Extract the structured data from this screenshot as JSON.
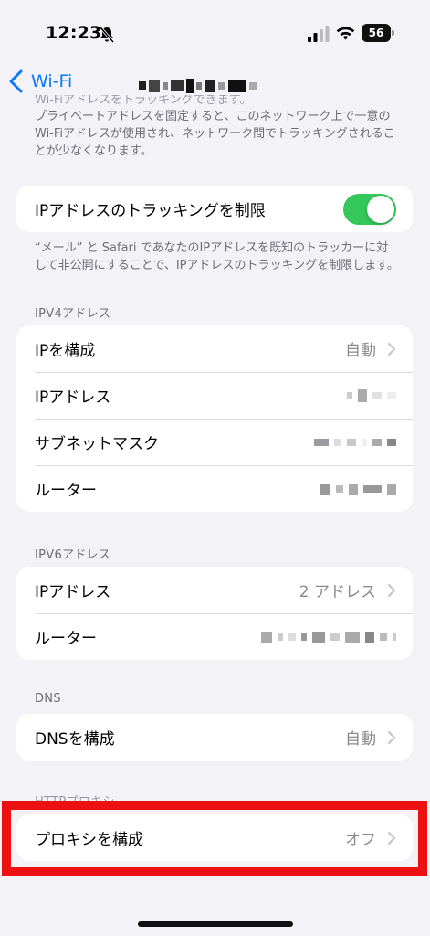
{
  "status": {
    "time": "12:23",
    "battery": "56"
  },
  "nav": {
    "back_label": "Wi-Fi"
  },
  "top_note": {
    "cut_line": "Wi-Fiアドレスをトラッキングできます。",
    "text": "プライベートアドレスを固定すると、このネットワーク上で一意のWi-Fiアドレスが使用され、ネットワーク間でトラッキングされることが少なくなります。"
  },
  "tracking": {
    "label": "IPアドレスのトラッキングを制限",
    "enabled": true,
    "footer": "“メール” と Safari であなたのIPアドレスを既知のトラッカーに対して非公開にすることで、IPアドレスのトラッキングを制限します。"
  },
  "ipv4": {
    "header": "IPV4アドレス",
    "configure_label": "IPを構成",
    "configure_value": "自動",
    "ip_label": "IPアドレス",
    "subnet_label": "サブネットマスク",
    "router_label": "ルーター"
  },
  "ipv6": {
    "header": "IPV6アドレス",
    "ip_label": "IPアドレス",
    "ip_value": "2 アドレス",
    "router_label": "ルーター"
  },
  "dns": {
    "header": "DNS",
    "configure_label": "DNSを構成",
    "configure_value": "自動"
  },
  "proxy": {
    "header": "HTTPプロキシ",
    "configure_label": "プロキシを構成",
    "configure_value": "オフ"
  },
  "colors": {
    "accent": "#0a7aff",
    "toggle_on": "#34c759",
    "highlight": "#ee1111"
  }
}
